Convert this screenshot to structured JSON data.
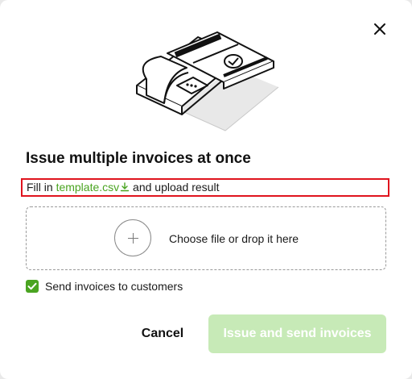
{
  "dialog": {
    "title": "Issue multiple invoices at once",
    "hint": {
      "prefix": "Fill in ",
      "link_text": "template.csv",
      "suffix": " and upload result"
    },
    "dropzone": {
      "label": "Choose file or drop it here"
    },
    "send_to_customers": {
      "label": "Send invoices to customers",
      "checked": true
    },
    "buttons": {
      "cancel_label": "Cancel",
      "primary_label": "Issue and send invoices",
      "primary_enabled": false
    },
    "icons": {
      "close": "close-icon",
      "download": "download-icon",
      "plus": "plus-icon",
      "check": "checkmark-icon"
    },
    "colors": {
      "accent": "#4aa421",
      "primary_disabled_bg": "#c7eab7",
      "highlight_border": "#e0141e"
    }
  }
}
